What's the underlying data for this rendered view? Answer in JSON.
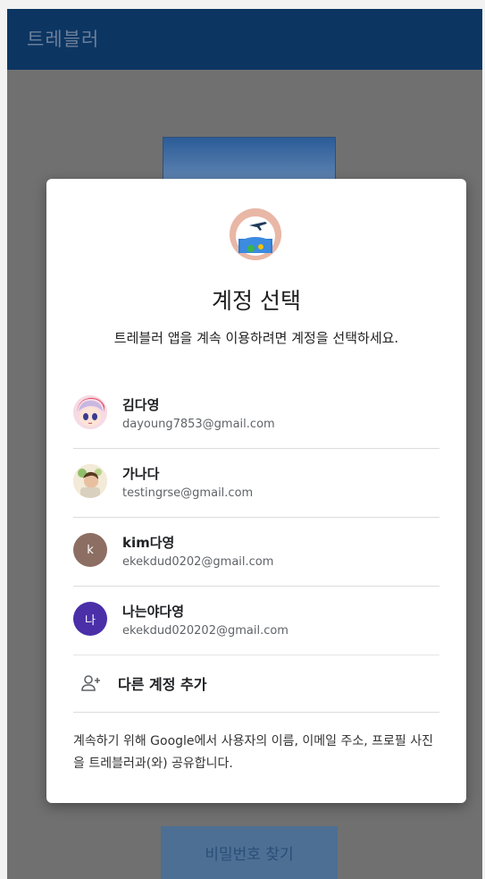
{
  "app_bar": {
    "title": "트레블러"
  },
  "background": {
    "find_password_button": "비밀번호 찾기"
  },
  "dialog": {
    "title": "계정 선택",
    "subtitle": "트레블러 앱을 계속 이용하려면 계정을 선택하세요.",
    "accounts": [
      {
        "name": "김다영",
        "email": "dayoung7853@gmail.com",
        "avatar": "anime-avatar"
      },
      {
        "name": "가나다",
        "email": "testingrse@gmail.com",
        "avatar": "photo-avatar"
      },
      {
        "name": "kim다영",
        "email": "ekekdud0202@gmail.com",
        "avatar_letter": "k",
        "avatar_color": "#8d6e63"
      },
      {
        "name": "나는야다영",
        "email": "ekekdud020202@gmail.com",
        "avatar_letter": "나",
        "avatar_color": "#4a2fa8"
      }
    ],
    "add_account_label": "다른 계정 추가",
    "disclaimer": "계속하기 위해 Google에서 사용자의 이름, 이메일 주소, 프로필 사진을 트레블러과(와) 공유합니다."
  },
  "colors": {
    "app_bar": "#0c3562",
    "scrim": "#707070",
    "dialog_bg": "#ffffff"
  }
}
